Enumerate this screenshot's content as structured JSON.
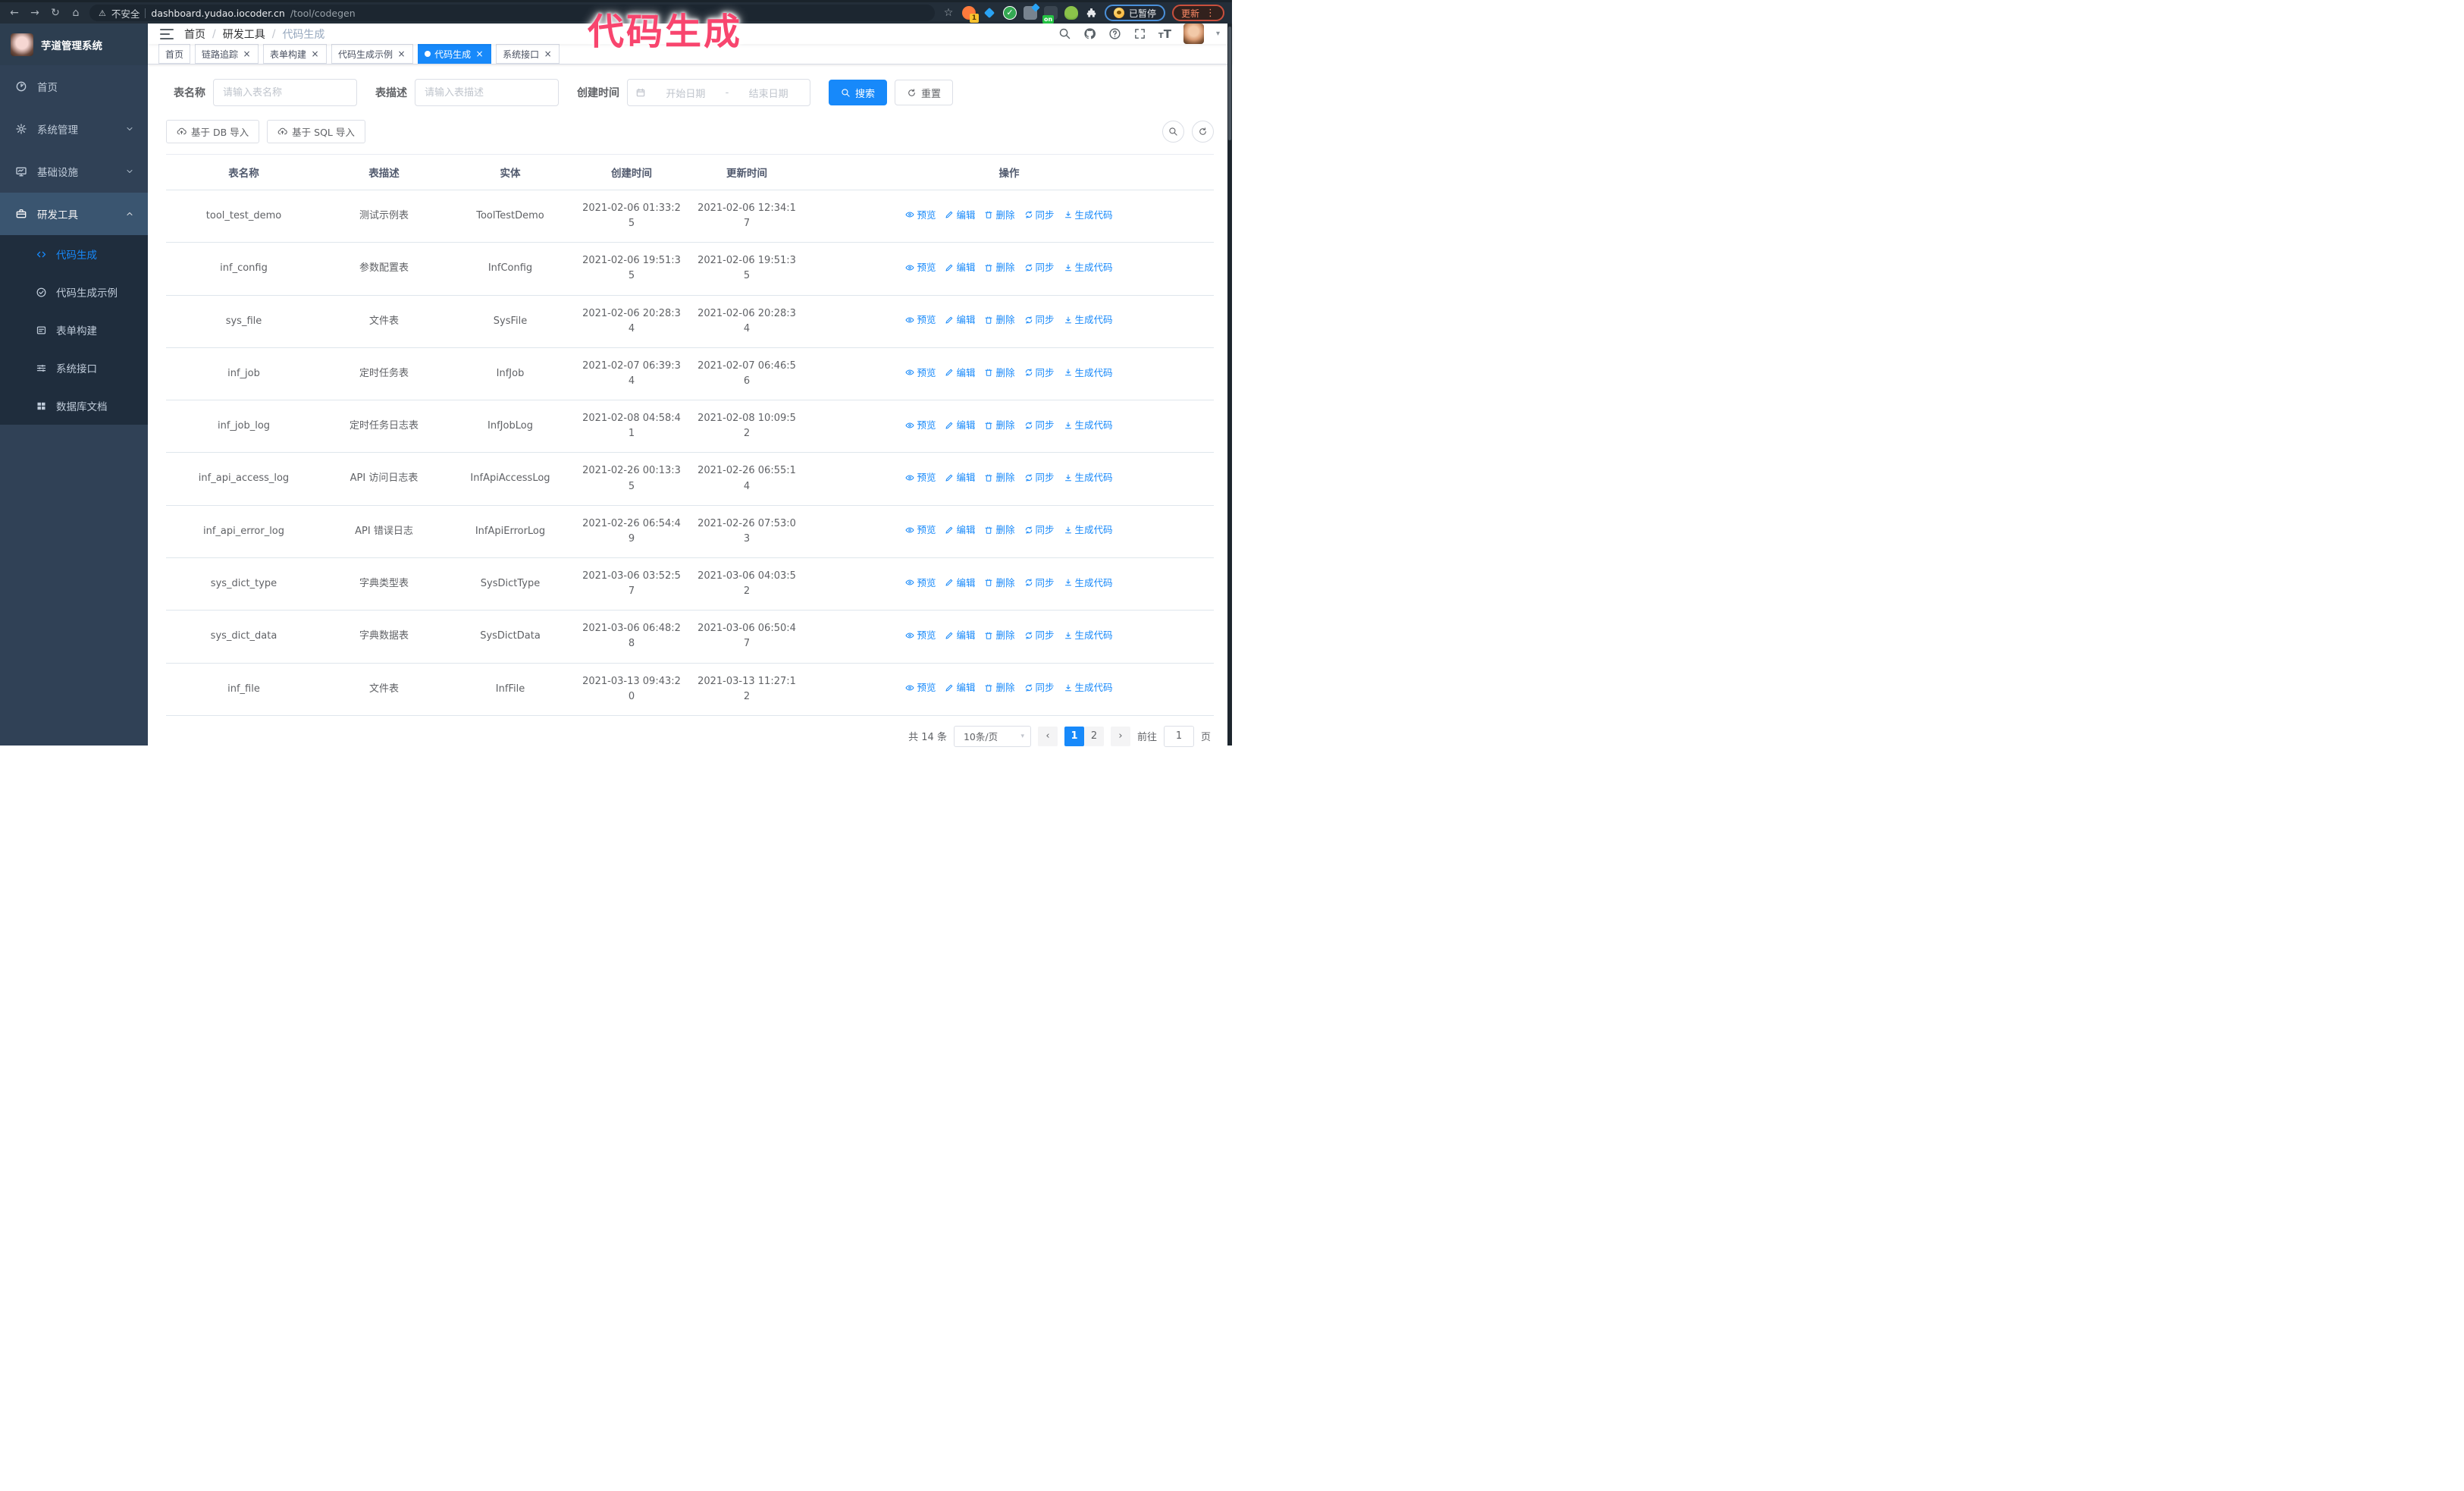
{
  "browser": {
    "security_label": "不安全",
    "url_host": "dashboard.yudao.iocoder.cn",
    "url_path": "/tool/codegen",
    "extension_badge": "1",
    "extension_on_badge": "on",
    "paused_badge": "已暂停",
    "update_button": "更新"
  },
  "annotation": {
    "text": "代码生成",
    "color": "#f8456e"
  },
  "icons": {
    "back": "←",
    "forward": "→",
    "reload": "↻",
    "home": "⌂",
    "star": "☆",
    "warning": "⚠",
    "dots": "⋮",
    "close": "×",
    "caret": "▾",
    "prev": "‹",
    "next": "›",
    "question": "?",
    "breadcrumb_sep": "/",
    "t_large": "T",
    "t_small": "T"
  },
  "sidebar": {
    "logo_title": "芋道管理系统",
    "items": [
      {
        "label": "首页",
        "icon": "home",
        "expandable": false,
        "expanded": false
      },
      {
        "label": "系统管理",
        "icon": "gear",
        "expandable": true,
        "expanded": false
      },
      {
        "label": "基础设施",
        "icon": "infra",
        "expandable": true,
        "expanded": false
      },
      {
        "label": "研发工具",
        "icon": "tools",
        "expandable": true,
        "expanded": true
      }
    ],
    "submenu": [
      {
        "label": "代码生成",
        "icon": "code",
        "active": true
      },
      {
        "label": "代码生成示例",
        "icon": "example",
        "active": false
      },
      {
        "label": "表单构建",
        "icon": "form",
        "active": false
      },
      {
        "label": "系统接口",
        "icon": "api",
        "active": false
      },
      {
        "label": "数据库文档",
        "icon": "dbdoc",
        "active": false
      }
    ]
  },
  "header": {
    "breadcrumb": [
      "首页",
      "研发工具",
      "代码生成"
    ]
  },
  "tabs": [
    {
      "label": "首页",
      "closable": false,
      "active": false
    },
    {
      "label": "链路追踪",
      "closable": true,
      "active": false
    },
    {
      "label": "表单构建",
      "closable": true,
      "active": false
    },
    {
      "label": "代码生成示例",
      "closable": true,
      "active": false
    },
    {
      "label": "代码生成",
      "closable": true,
      "active": true
    },
    {
      "label": "系统接口",
      "closable": true,
      "active": false
    }
  ],
  "filters": {
    "table_name_label": "表名称",
    "table_name_placeholder": "请输入表名称",
    "table_desc_label": "表描述",
    "table_desc_placeholder": "请输入表描述",
    "create_time_label": "创建时间",
    "date_start_placeholder": "开始日期",
    "date_separator": "-",
    "date_end_placeholder": "结束日期",
    "search_button": "搜索",
    "reset_button": "重置"
  },
  "toolbar": {
    "import_db_button": "基于 DB 导入",
    "import_sql_button": "基于 SQL 导入"
  },
  "table": {
    "columns": [
      "表名称",
      "表描述",
      "实体",
      "创建时间",
      "更新时间",
      "操作"
    ],
    "actions": [
      {
        "key": "preview",
        "label": "预览",
        "icon": "eye"
      },
      {
        "key": "edit",
        "label": "编辑",
        "icon": "edit"
      },
      {
        "key": "delete",
        "label": "删除",
        "icon": "delete"
      },
      {
        "key": "sync",
        "label": "同步",
        "icon": "sync"
      },
      {
        "key": "generate",
        "label": "生成代码",
        "icon": "download"
      }
    ],
    "rows": [
      {
        "name": "tool_test_demo",
        "desc": "测试示例表",
        "entity": "ToolTestDemo",
        "created": "2021-02-06 01:33:25",
        "updated": "2021-02-06 12:34:17"
      },
      {
        "name": "inf_config",
        "desc": "参数配置表",
        "entity": "InfConfig",
        "created": "2021-02-06 19:51:35",
        "updated": "2021-02-06 19:51:35"
      },
      {
        "name": "sys_file",
        "desc": "文件表",
        "entity": "SysFile",
        "created": "2021-02-06 20:28:34",
        "updated": "2021-02-06 20:28:34"
      },
      {
        "name": "inf_job",
        "desc": "定时任务表",
        "entity": "InfJob",
        "created": "2021-02-07 06:39:34",
        "updated": "2021-02-07 06:46:56"
      },
      {
        "name": "inf_job_log",
        "desc": "定时任务日志表",
        "entity": "InfJobLog",
        "created": "2021-02-08 04:58:41",
        "updated": "2021-02-08 10:09:52"
      },
      {
        "name": "inf_api_access_log",
        "desc": "API 访问日志表",
        "entity": "InfApiAccessLog",
        "created": "2021-02-26 00:13:35",
        "updated": "2021-02-26 06:55:14"
      },
      {
        "name": "inf_api_error_log",
        "desc": "API 错误日志",
        "entity": "InfApiErrorLog",
        "created": "2021-02-26 06:54:49",
        "updated": "2021-02-26 07:53:03"
      },
      {
        "name": "sys_dict_type",
        "desc": "字典类型表",
        "entity": "SysDictType",
        "created": "2021-03-06 03:52:57",
        "updated": "2021-03-06 04:03:52"
      },
      {
        "name": "sys_dict_data",
        "desc": "字典数据表",
        "entity": "SysDictData",
        "created": "2021-03-06 06:48:28",
        "updated": "2021-03-06 06:50:47"
      },
      {
        "name": "inf_file",
        "desc": "文件表",
        "entity": "InfFile",
        "created": "2021-03-13 09:43:20",
        "updated": "2021-03-13 11:27:12"
      }
    ]
  },
  "pagination": {
    "total": "共 14 条",
    "page_size": "10条/页",
    "pages": [
      "1",
      "2"
    ],
    "active_page": "1",
    "goto_label": "前往",
    "goto_value": "1",
    "goto_suffix": "页"
  },
  "colors": {
    "primary": "#1789fa",
    "sidebar_bg": "#304156",
    "submenu_bg": "#1f2d3d",
    "annotation_pink": "#f8456e",
    "browser_bar_bg": "#232e39"
  }
}
